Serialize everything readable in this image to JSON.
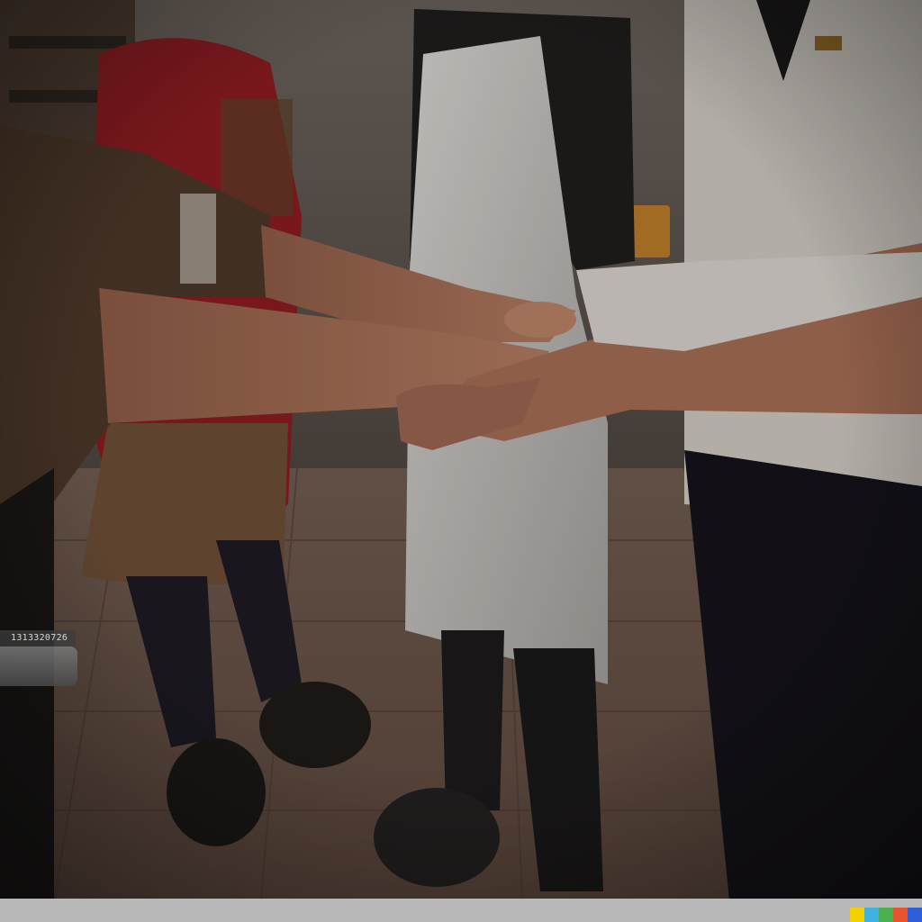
{
  "image": {
    "description_free": true
  },
  "stock_id": {
    "text": "1313320726"
  },
  "watermark": {
    "colors": [
      "#f5d000",
      "#3fb3e0",
      "#4caf50",
      "#e8542e",
      "#2e5fd8"
    ]
  },
  "palette": {
    "wall": "#5a4e46",
    "floor": "#6b5448",
    "brown_shirt": "#4a3628",
    "red_shirt": "#9a1f25",
    "apron": "#c9c6c2",
    "chef_coat": "#cfc9c2",
    "skin": "#a9705a",
    "dark": "#1f1a18"
  }
}
